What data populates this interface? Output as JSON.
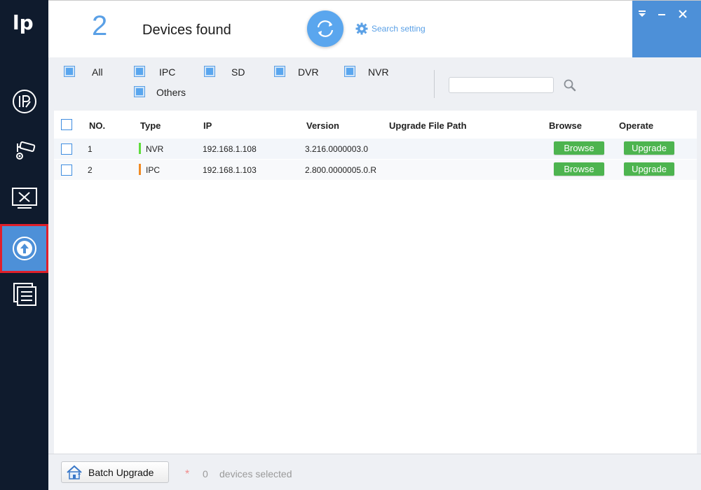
{
  "header": {
    "device_count": "2",
    "found_label": "Devices found",
    "search_setting_label": "Search setting"
  },
  "filters": [
    {
      "label": "All",
      "checked": true
    },
    {
      "label": "IPC",
      "checked": true
    },
    {
      "label": "SD",
      "checked": true
    },
    {
      "label": "DVR",
      "checked": true
    },
    {
      "label": "NVR",
      "checked": true
    },
    {
      "label": "Others",
      "checked": true
    }
  ],
  "search": {
    "value": "",
    "placeholder": ""
  },
  "table": {
    "columns": [
      "NO.",
      "Type",
      "IP",
      "Version",
      "Upgrade File Path",
      "Browse",
      "Operate"
    ],
    "rows": [
      {
        "no": "1",
        "type": "NVR",
        "type_color": "#5fdc3c",
        "ip": "192.168.1.108",
        "version": "3.216.0000003.0",
        "path": "",
        "browse": "Browse",
        "operate": "Upgrade"
      },
      {
        "no": "2",
        "type": "IPC",
        "type_color": "#f08a24",
        "ip": "192.168.1.103",
        "version": "2.800.0000005.0.R",
        "path": "",
        "browse": "Browse",
        "operate": "Upgrade"
      }
    ]
  },
  "footer": {
    "batch_label": "Batch Upgrade",
    "star": "*",
    "selected_count": "0",
    "selected_label": "devices selected"
  },
  "colors": {
    "sidebar": "#0f1b2d",
    "accent": "#4d90d8",
    "active_outline": "#e0202a",
    "button_green": "#4db44f"
  },
  "icons": {
    "sidebar": [
      "ip-config-icon",
      "camera-settings-icon",
      "system-tools-icon",
      "upgrade-icon",
      "document-list-icon"
    ]
  }
}
